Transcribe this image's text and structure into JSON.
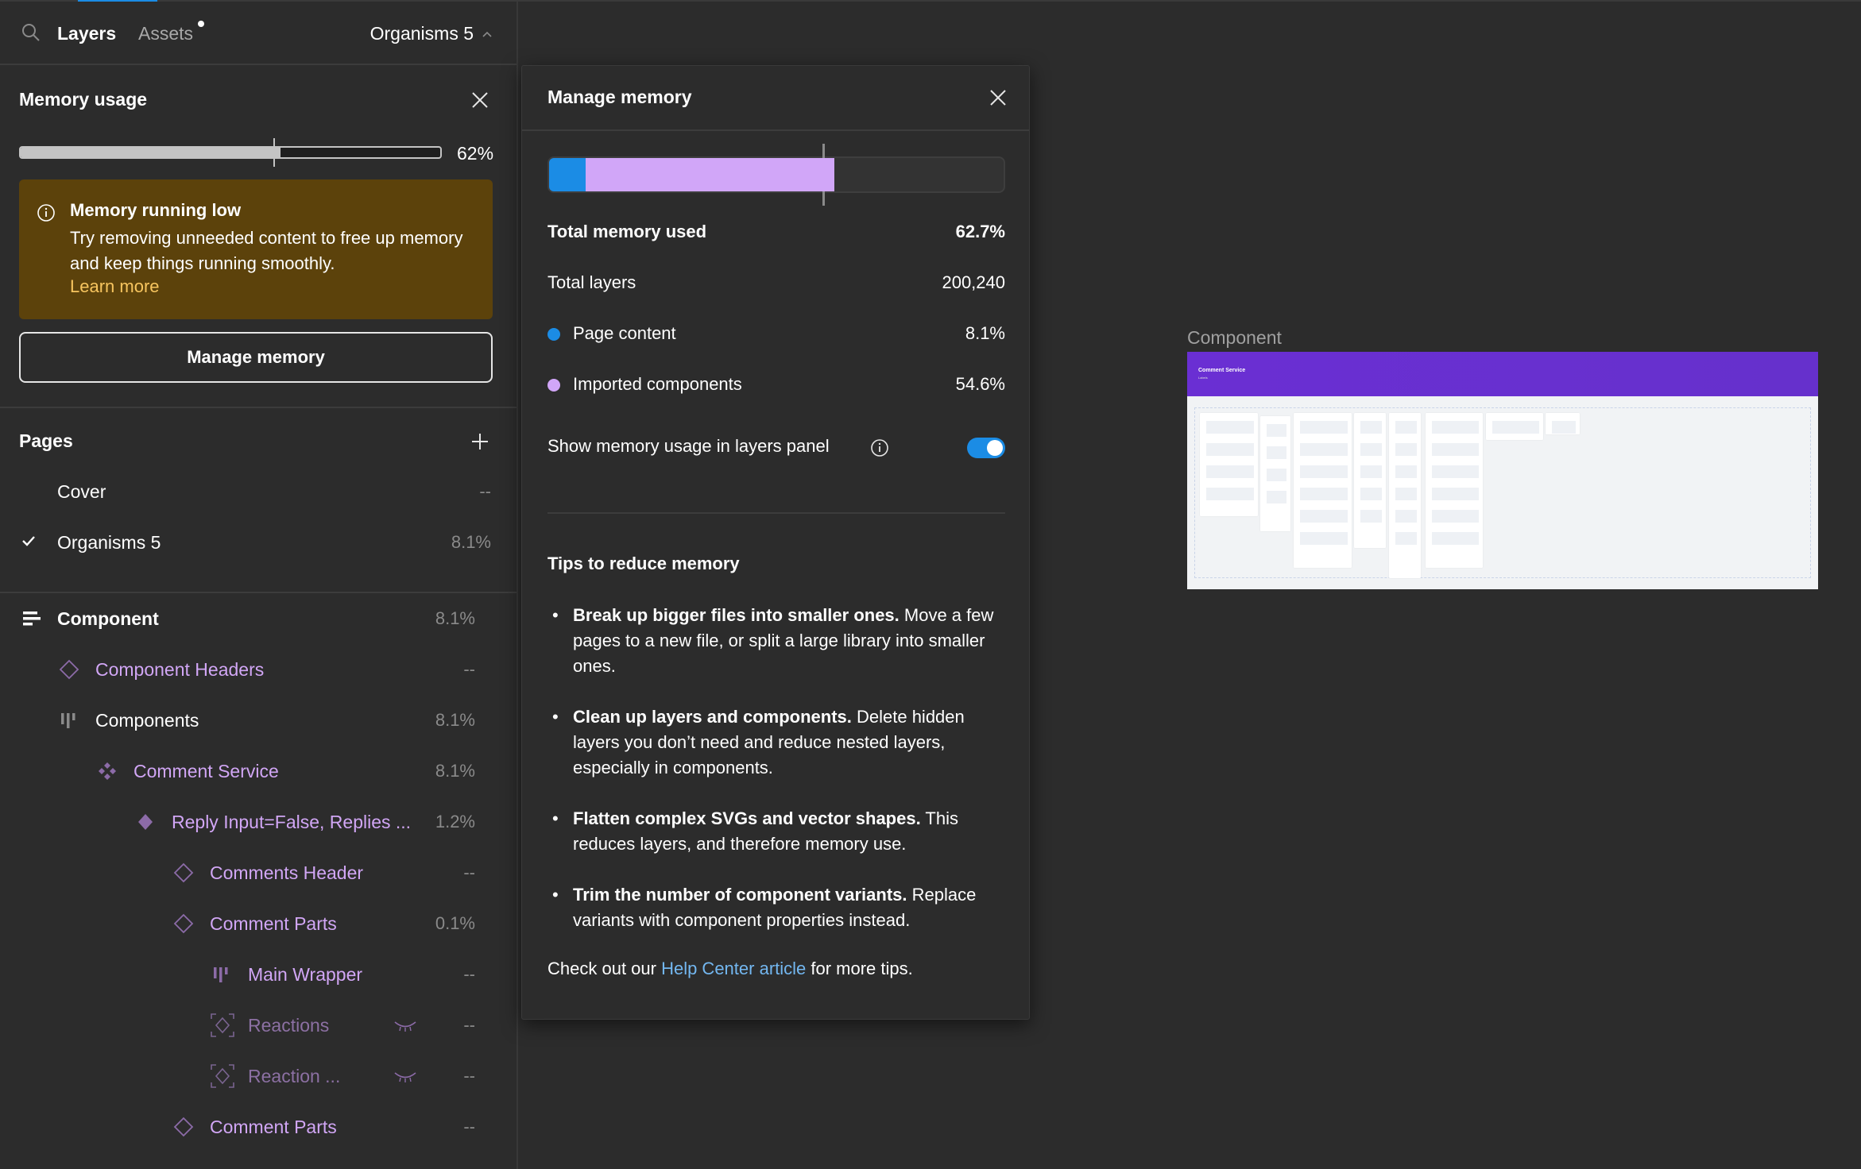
{
  "header": {
    "tabs": [
      {
        "label": "Layers",
        "active": true
      },
      {
        "label": "Assets",
        "active": false,
        "has_notification_dot": true
      }
    ],
    "current_page": "Organisms 5",
    "icons": {
      "search": "search-icon",
      "page_toggle": "chevron-up-icon"
    }
  },
  "memory_usage": {
    "title": "Memory usage",
    "percent_label": "62%",
    "progress_fraction": 0.62,
    "warning": {
      "title": "Memory running low",
      "text": "Try removing unneeded content to free up memory and keep things running smoothly.",
      "link": "Learn more"
    },
    "manage_button": "Manage memory"
  },
  "pages": {
    "title": "Pages",
    "items": [
      {
        "name": "Cover",
        "value": "--",
        "current": false
      },
      {
        "name": "Organisms 5",
        "value": "8.1%",
        "current": true
      }
    ]
  },
  "layers": [
    {
      "name": "Component",
      "value": "8.1%",
      "icon": "section-icon",
      "depth": 0,
      "style": "white-bold",
      "hidden": false
    },
    {
      "name": "Component Headers",
      "value": "--",
      "icon": "component-instance-icon",
      "depth": 1,
      "style": "purple",
      "hidden": false
    },
    {
      "name": "Components",
      "value": "8.1%",
      "icon": "auto-layout-icon",
      "depth": 1,
      "style": "white",
      "hidden": false
    },
    {
      "name": "Comment Service",
      "value": "8.1%",
      "icon": "component-set-icon",
      "depth": 2,
      "style": "purple",
      "hidden": false
    },
    {
      "name": "Reply Input=False, Replies ...",
      "value": "1.2%",
      "icon": "main-component-icon",
      "depth": 3,
      "style": "purple",
      "hidden": false
    },
    {
      "name": "Comments Header",
      "value": "--",
      "icon": "component-instance-icon",
      "depth": 4,
      "style": "purple",
      "hidden": false
    },
    {
      "name": "Comment Parts",
      "value": "0.1%",
      "icon": "component-instance-icon",
      "depth": 4,
      "style": "purple",
      "hidden": false
    },
    {
      "name": "Main Wrapper",
      "value": "--",
      "icon": "auto-layout-icon",
      "depth": 5,
      "style": "purple",
      "hidden": false
    },
    {
      "name": "Reactions",
      "value": "--",
      "icon": "hidden-instance-icon",
      "depth": 5,
      "style": "purple",
      "hidden": true
    },
    {
      "name": "Reaction ...",
      "value": "--",
      "icon": "hidden-instance-icon",
      "depth": 5,
      "style": "purple",
      "hidden": true
    },
    {
      "name": "Comment Parts",
      "value": "--",
      "icon": "component-instance-icon",
      "depth": 4,
      "style": "purple",
      "hidden": false
    }
  ],
  "modal": {
    "title": "Manage memory",
    "bar": {
      "page_content_percent": 8.1,
      "imported_components_percent": 54.6,
      "threshold_percent": 60
    },
    "stats": [
      {
        "label": "Total memory used",
        "value": "62.7%"
      },
      {
        "label": "Total layers",
        "value": "200,240"
      }
    ],
    "breakdown": [
      {
        "label": "Page content",
        "value": "8.1%",
        "color": "#1b8ce5"
      },
      {
        "label": "Imported components",
        "value": "54.6%",
        "color": "#d1a6f8"
      }
    ],
    "toggle": {
      "label": "Show memory usage in layers panel",
      "on": true
    },
    "tips_title": "Tips to reduce memory",
    "tips": [
      {
        "bold": "Break up bigger files into smaller ones.",
        "text": " Move a few pages to a new file, or split a large library into smaller ones."
      },
      {
        "bold": "Clean up layers and components.",
        "text": " Delete hidden layers you don’t need and reduce nested layers, especially in components."
      },
      {
        "bold": "Flatten complex SVGs and vector shapes.",
        "text": " This reduces layers, and therefore memory use."
      },
      {
        "bold": "Trim the number of component variants.",
        "text": " Replace variants with component properties instead."
      }
    ],
    "help": {
      "prefix": "Check out our ",
      "link": "Help Center article",
      "suffix": " for more tips."
    }
  },
  "canvas": {
    "frame_label": "Component",
    "frame_title": "Comment Service",
    "frame_subtitle": "Labels",
    "accent_color": "#6a2fd3"
  }
}
